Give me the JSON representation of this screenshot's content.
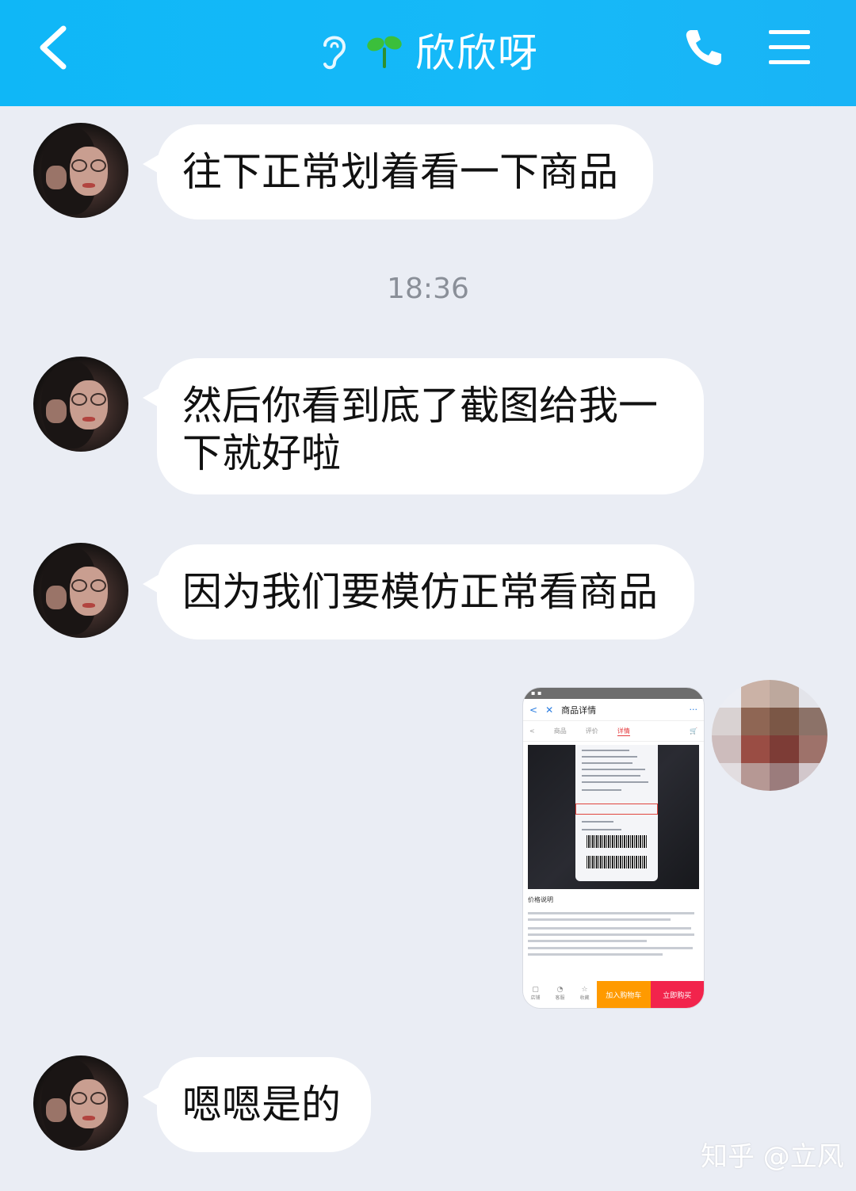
{
  "header": {
    "title": "欣欣呀",
    "icons": {
      "back": "back-chevron-icon",
      "ear": "ear-icon",
      "sprout": "sprout-icon",
      "phone": "phone-icon",
      "menu": "menu-icon"
    }
  },
  "messages": [
    {
      "text": "往下正常划着看一下商品"
    },
    {
      "text": "然后你看到底了截图给我一下就好啦"
    },
    {
      "text": "因为我们要模仿正常看商品"
    },
    {
      "text": "嗯嗯是的"
    }
  ],
  "timestamp": "18:36",
  "screenshot": {
    "nav_title": "商品详情",
    "tabs": [
      "商品",
      "评价",
      "详情"
    ],
    "section_title": "价格说明",
    "add_to_cart": "加入购物车",
    "buy_now": "立即购买",
    "bottom_icons": [
      "店铺",
      "客服",
      "收藏"
    ]
  },
  "watermark": "知乎 @立风",
  "colors": {
    "header": "#16b9f8",
    "background": "#eaedf4",
    "bubble": "#ffffff",
    "cart": "#ff9a00",
    "buy": "#f2244c"
  }
}
